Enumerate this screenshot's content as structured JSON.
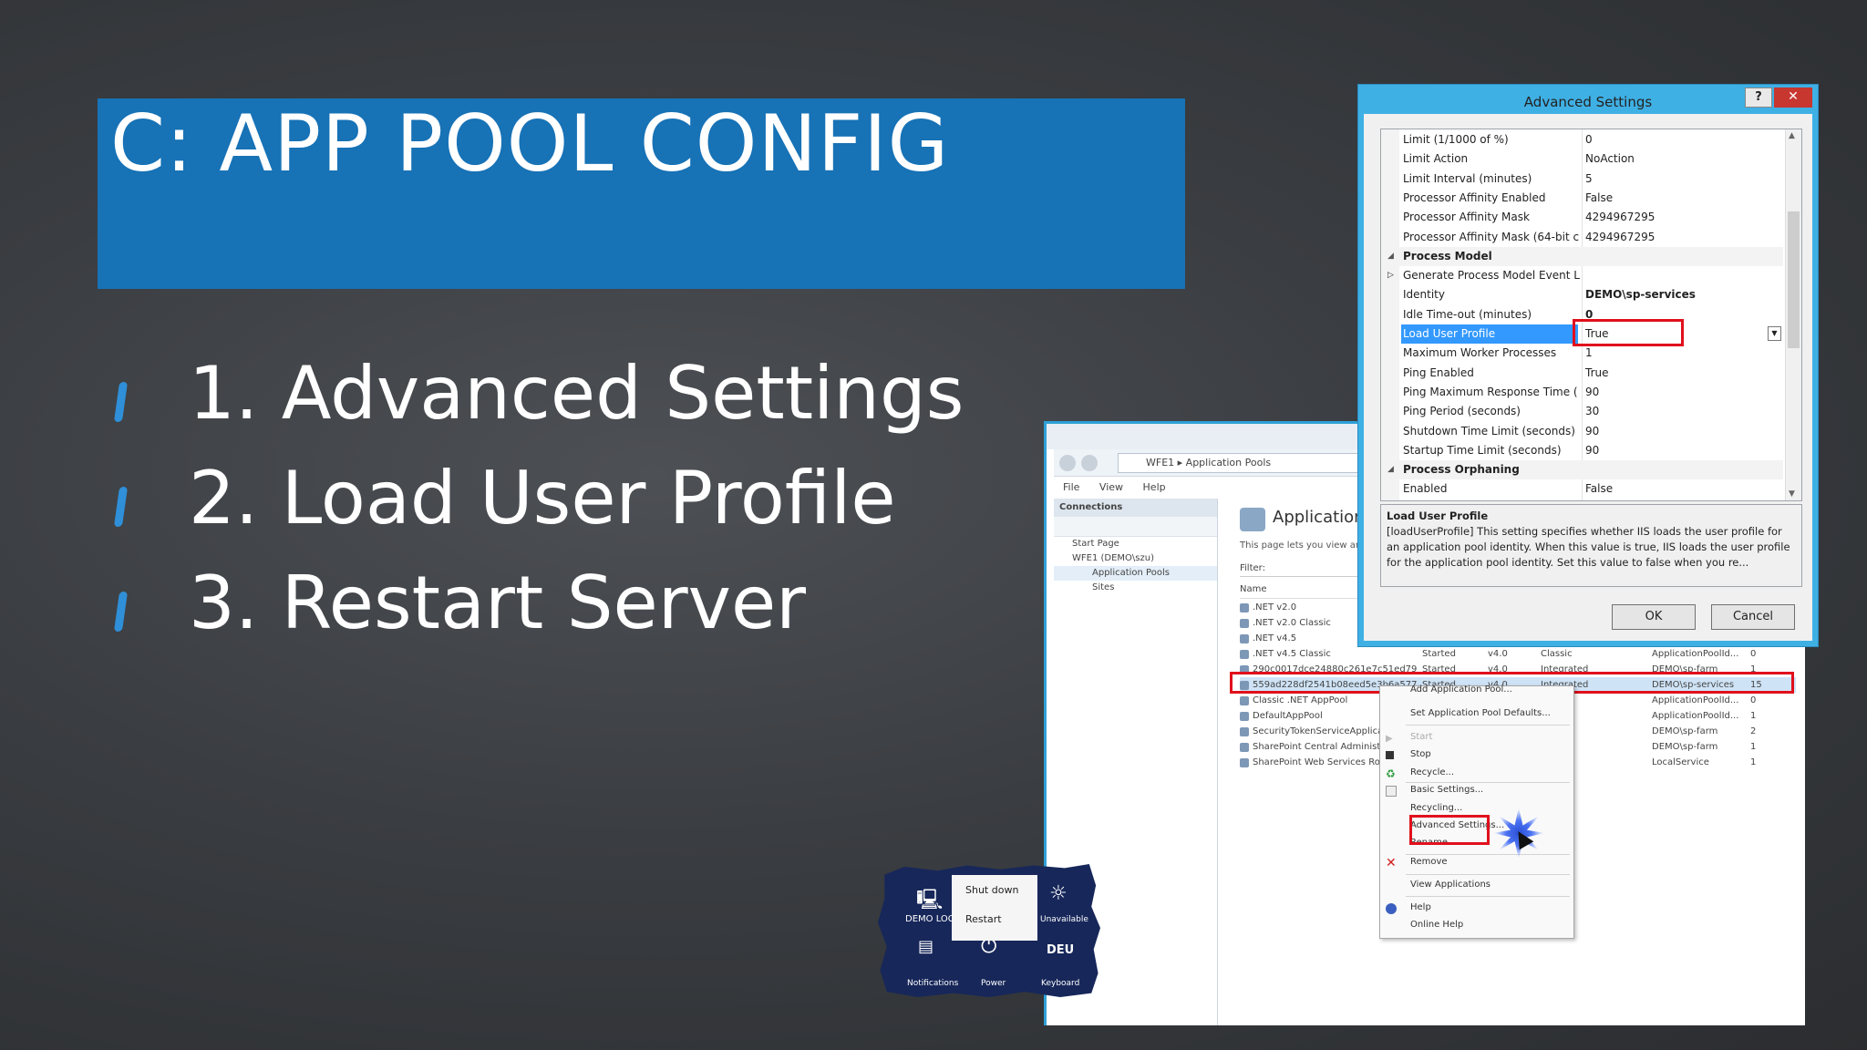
{
  "slide": {
    "title": "C: APP POOL CONFIG",
    "bullets": [
      "1. Advanced Settings",
      "2. Load User Profile",
      "3. Restart Server"
    ]
  },
  "iis": {
    "breadcrumb": "WFE1  ▸  Application Pools",
    "menu": [
      "File",
      "View",
      "Help"
    ],
    "connections_label": "Connections",
    "tree": [
      "Start Page",
      "WFE1 (DEMO\\szu)",
      "Application Pools",
      "Sites"
    ],
    "page_title": "Application P",
    "page_desc": "This page lets you view and m",
    "filter_label": "Filter:",
    "name_col": "Name",
    "pools": [
      {
        "name": ".NET v2.0",
        "status": "",
        "clr": "",
        "mode": "",
        "identity": "",
        "apps": ""
      },
      {
        "name": ".NET v2.0 Classic",
        "status": "",
        "clr": "",
        "mode": "",
        "identity": "",
        "apps": ""
      },
      {
        "name": ".NET v4.5",
        "status": "",
        "clr": "",
        "mode": "",
        "identity": "",
        "apps": ""
      },
      {
        "name": ".NET v4.5 Classic",
        "status": "Started",
        "clr": "v4.0",
        "mode": "Classic",
        "identity": "ApplicationPoolId...",
        "apps": "0"
      },
      {
        "name": "290c0017dce24880c261e7c51ed7985",
        "status": "Started",
        "clr": "v4.0",
        "mode": "Integrated",
        "identity": "DEMO\\sp-farm",
        "apps": "1"
      },
      {
        "name": "559ad228df2541b08eed5e3b6a57772a",
        "status": "Started",
        "clr": "v4.0",
        "mode": "Integrated",
        "identity": "DEMO\\sp-services",
        "apps": "15"
      },
      {
        "name": "Classic .NET AppPool",
        "status": "",
        "clr": "",
        "mode": "",
        "identity": "ApplicationPoolId...",
        "apps": "0"
      },
      {
        "name": "DefaultAppPool",
        "status": "",
        "clr": "",
        "mode": "",
        "identity": "ApplicationPoolId...",
        "apps": "1"
      },
      {
        "name": "SecurityTokenServiceApplicati",
        "status": "",
        "clr": "",
        "mode": "",
        "identity": "DEMO\\sp-farm",
        "apps": "2"
      },
      {
        "name": "SharePoint Central Administrat",
        "status": "",
        "clr": "",
        "mode": "",
        "identity": "DEMO\\sp-farm",
        "apps": "1"
      },
      {
        "name": "SharePoint Web Services Root",
        "status": "",
        "clr": "",
        "mode": "",
        "identity": "LocalService",
        "apps": "1"
      }
    ]
  },
  "context_menu": {
    "items": [
      "Add Application Pool...",
      "Set Application Pool Defaults...",
      "Start",
      "Stop",
      "Recycle...",
      "Basic Settings...",
      "Recycling...",
      "Advanced Settings...",
      "Rename",
      "Remove",
      "View Applications",
      "Help",
      "Online Help"
    ]
  },
  "dialog": {
    "title": "Advanced Settings",
    "help": "?",
    "close": "✕",
    "rows": [
      {
        "name": "Limit (1/1000 of %)",
        "value": "0"
      },
      {
        "name": "Limit Action",
        "value": "NoAction"
      },
      {
        "name": "Limit Interval (minutes)",
        "value": "5"
      },
      {
        "name": "Processor Affinity Enabled",
        "value": "False"
      },
      {
        "name": "Processor Affinity Mask",
        "value": "4294967295"
      },
      {
        "name": "Processor Affinity Mask (64-bit c",
        "value": "4294967295"
      },
      {
        "name": "Process Model",
        "value": ""
      },
      {
        "name": "Generate Process Model Event L",
        "value": ""
      },
      {
        "name": "Identity",
        "value": "DEMO\\sp-services"
      },
      {
        "name": "Idle Time-out (minutes)",
        "value": "0"
      },
      {
        "name": "Load User Profile",
        "value": "True"
      },
      {
        "name": "Maximum Worker Processes",
        "value": "1"
      },
      {
        "name": "Ping Enabled",
        "value": "True"
      },
      {
        "name": "Ping Maximum Response Time (",
        "value": "90"
      },
      {
        "name": "Ping Period (seconds)",
        "value": "30"
      },
      {
        "name": "Shutdown Time Limit (seconds)",
        "value": "90"
      },
      {
        "name": "Startup Time Limit (seconds)",
        "value": "90"
      },
      {
        "name": "Process Orphaning",
        "value": ""
      },
      {
        "name": "Enabled",
        "value": "False"
      }
    ],
    "desc_title": "Load User Profile",
    "desc_text": "[loadUserProfile] This setting specifies whether IIS loads the user profile for an application pool identity. When this value is true, IIS loads the user profile for the application pool identity. Set this value to false when you re...",
    "ok": "OK",
    "cancel": "Cancel"
  },
  "charm": {
    "shut_down": "Shut down",
    "restart": "Restart",
    "computer": "DEMO LOC",
    "unavailable": "Unavailable",
    "notifications": "Notifications",
    "power": "Power",
    "keyboard_code": "DEU",
    "keyboard": "Keyboard"
  }
}
